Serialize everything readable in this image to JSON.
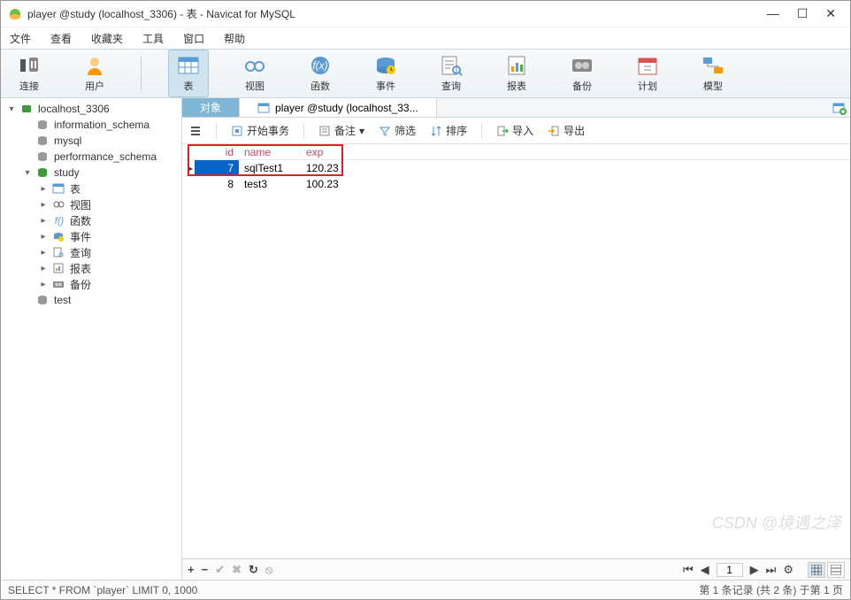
{
  "window": {
    "title": "player @study (localhost_3306) - 表 - Navicat for MySQL"
  },
  "menubar": {
    "items": [
      "文件",
      "查看",
      "收藏夹",
      "工具",
      "窗口",
      "帮助"
    ]
  },
  "maintoolbar": {
    "items": [
      {
        "label": "连接",
        "icon": "plug-icon"
      },
      {
        "label": "用户",
        "icon": "user-icon"
      },
      {
        "label": "表",
        "icon": "table-icon",
        "active": true
      },
      {
        "label": "视图",
        "icon": "view-icon"
      },
      {
        "label": "函数",
        "icon": "function-icon"
      },
      {
        "label": "事件",
        "icon": "event-icon"
      },
      {
        "label": "查询",
        "icon": "query-icon"
      },
      {
        "label": "报表",
        "icon": "report-icon"
      },
      {
        "label": "备份",
        "icon": "backup-icon"
      },
      {
        "label": "计划",
        "icon": "schedule-icon"
      },
      {
        "label": "模型",
        "icon": "model-icon"
      }
    ]
  },
  "sidebar": {
    "items": [
      {
        "label": "localhost_3306",
        "icon": "server",
        "arrow": "▾",
        "indent": 0,
        "color": "#3a9d3a"
      },
      {
        "label": "information_schema",
        "icon": "db",
        "arrow": "",
        "indent": 1,
        "color": "#999"
      },
      {
        "label": "mysql",
        "icon": "db",
        "arrow": "",
        "indent": 1,
        "color": "#999"
      },
      {
        "label": "performance_schema",
        "icon": "db",
        "arrow": "",
        "indent": 1,
        "color": "#999"
      },
      {
        "label": "study",
        "icon": "db",
        "arrow": "▾",
        "indent": 1,
        "color": "#3a9d3a"
      },
      {
        "label": "表",
        "icon": "tables",
        "arrow": "▸",
        "indent": 2
      },
      {
        "label": "视图",
        "icon": "views",
        "arrow": "▸",
        "indent": 2
      },
      {
        "label": "函数",
        "icon": "fx",
        "arrow": "▸",
        "indent": 2
      },
      {
        "label": "事件",
        "icon": "event",
        "arrow": "▸",
        "indent": 2
      },
      {
        "label": "查询",
        "icon": "query",
        "arrow": "▸",
        "indent": 2
      },
      {
        "label": "报表",
        "icon": "report",
        "arrow": "▸",
        "indent": 2
      },
      {
        "label": "备份",
        "icon": "backup",
        "arrow": "▸",
        "indent": 2
      },
      {
        "label": "test",
        "icon": "db",
        "arrow": "",
        "indent": 1,
        "color": "#999"
      }
    ]
  },
  "tabs": {
    "object": "对象",
    "file": "player @study (localhost_33..."
  },
  "actionbar": {
    "start_transaction": "开始事务",
    "memo": "备注",
    "filter": "筛选",
    "sort": "排序",
    "import": "导入",
    "export": "导出"
  },
  "grid": {
    "columns": [
      "id",
      "name",
      "exp"
    ],
    "rows": [
      {
        "id": "7",
        "name": "sqlTest1",
        "exp": "120.23",
        "selected": true,
        "pointer": true
      },
      {
        "id": "8",
        "name": "test3",
        "exp": "100.23",
        "selected": false,
        "pointer": false
      }
    ]
  },
  "bottombar": {
    "page": "1"
  },
  "statusbar": {
    "sql": "SELECT * FROM `player` LIMIT 0, 1000",
    "info": "第 1 条记录 (共 2 条) 于第 1 页"
  },
  "watermark": "CSDN @境遇之泽"
}
